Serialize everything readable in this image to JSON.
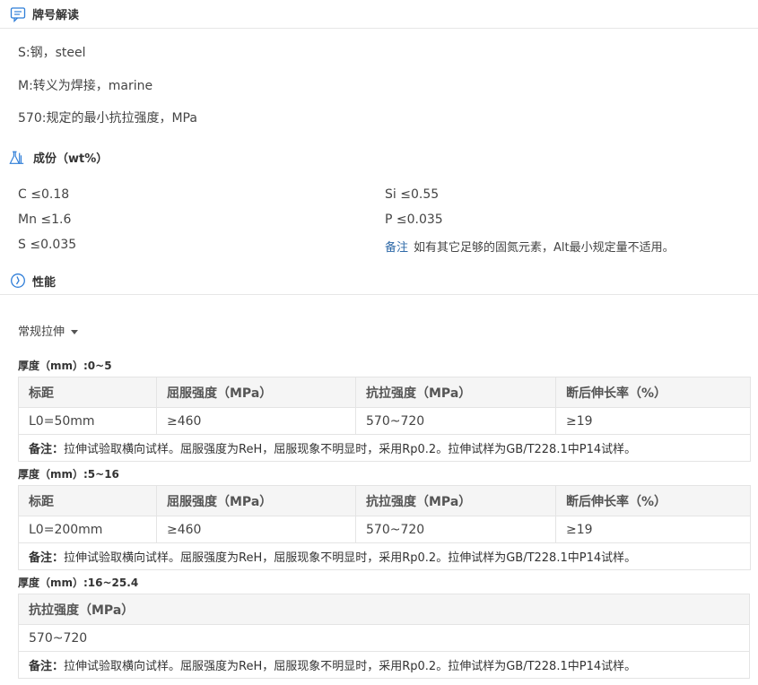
{
  "designation": {
    "title": "牌号解读",
    "lines": [
      "S:钢，steel",
      "M:转义为焊接，marine",
      "570:规定的最小抗拉强度，MPa"
    ]
  },
  "composition": {
    "title": "成份（wt%）",
    "left": [
      {
        "el": "C",
        "val": "≤0.18"
      },
      {
        "el": "Mn",
        "val": "≤1.6"
      },
      {
        "el": "S",
        "val": "≤0.035"
      }
    ],
    "right": [
      {
        "el": "Si",
        "val": "≤0.55"
      },
      {
        "el": "P",
        "val": "≤0.035"
      }
    ],
    "note_key": "备注",
    "note_text": "如有其它足够的固氮元素，Alt最小规定量不适用。"
  },
  "performance": {
    "title": "性能",
    "dropdown": "常规拉伸",
    "tables": [
      {
        "thickness": "厚度（mm）:0~5",
        "headers": [
          "标距",
          "屈服强度（MPa）",
          "抗拉强度（MPa）",
          "断后伸长率（%）"
        ],
        "row": [
          "L0=50mm",
          "≥460",
          "570~720",
          "≥19"
        ],
        "remark_key": "备注：",
        "remark": "拉伸试验取横向试样。屈服强度为ReH，屈服现象不明显时，采用Rp0.2。拉伸试样为GB/T228.1中P14试样。"
      },
      {
        "thickness": "厚度（mm）:5~16",
        "headers": [
          "标距",
          "屈服强度（MPa）",
          "抗拉强度（MPa）",
          "断后伸长率（%）"
        ],
        "row": [
          "L0=200mm",
          "≥460",
          "570~720",
          "≥19"
        ],
        "remark_key": "备注：",
        "remark": "拉伸试验取横向试样。屈服强度为ReH，屈服现象不明显时，采用Rp0.2。拉伸试样为GB/T228.1中P14试样。"
      },
      {
        "thickness": "厚度（mm）:16~25.4",
        "headers": [
          "抗拉强度（MPa）"
        ],
        "row": [
          "570~720"
        ],
        "remark_key": "备注：",
        "remark": "拉伸试验取横向试样。屈服强度为ReH，屈服现象不明显时，采用Rp0.2。拉伸试样为GB/T228.1中P14试样。"
      }
    ]
  },
  "colors": {
    "icon": "#2f7ed8",
    "border": "#e4e4e4",
    "header_bg": "#f5f5f5",
    "note_key": "#2f6aa8"
  },
  "icons": [
    "comment-icon",
    "flask-icon",
    "clock-icon",
    "caret-down-icon"
  ]
}
